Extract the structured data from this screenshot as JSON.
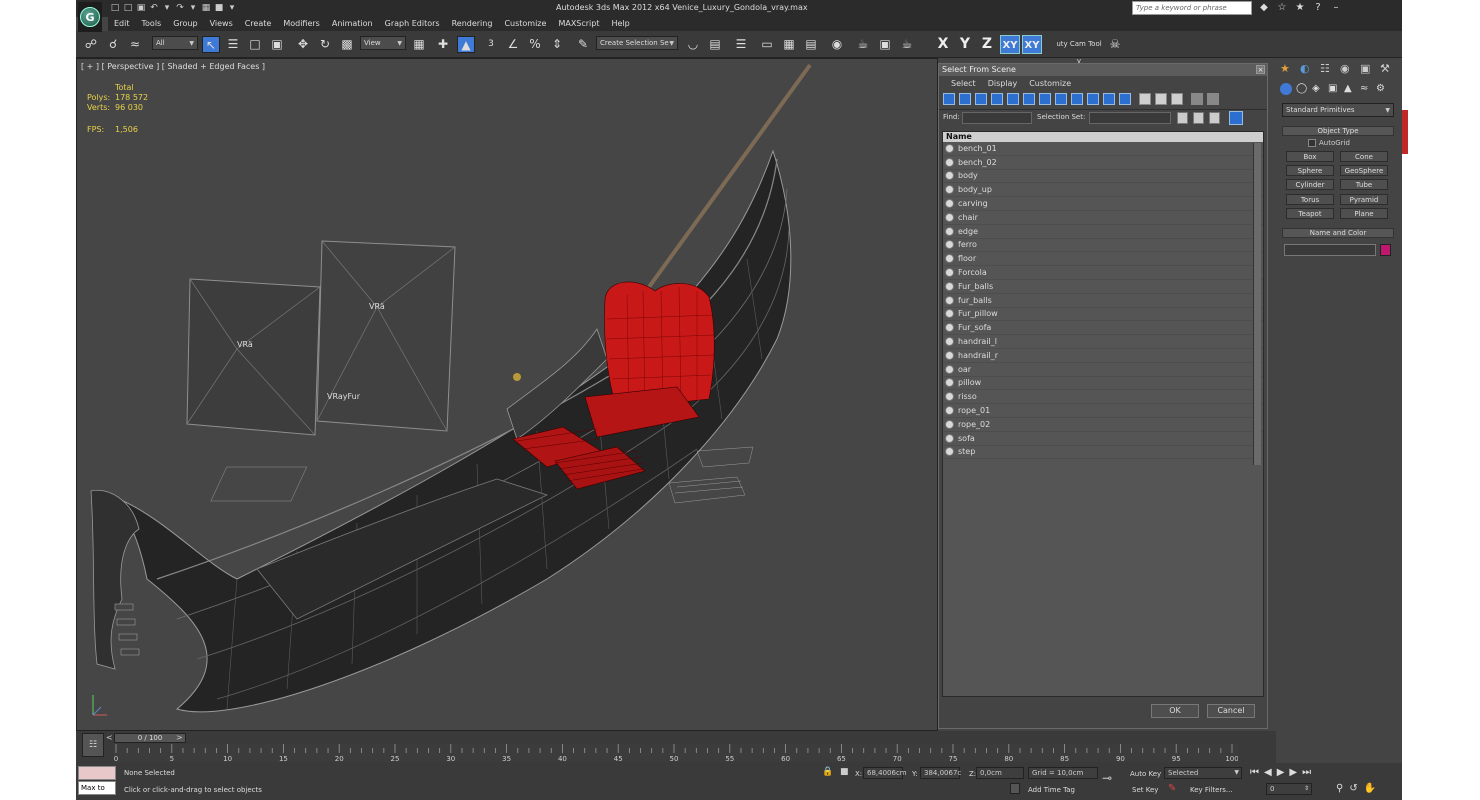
{
  "window": {
    "title": "Autodesk 3ds Max  2012 x64     Venice_Luxury_Gondola_vray.max",
    "help_placeholder": "Type a keyword or phrase",
    "logo_letter": "G"
  },
  "menu": [
    "Edit",
    "Tools",
    "Group",
    "Views",
    "Create",
    "Modifiers",
    "Animation",
    "Graph Editors",
    "Rendering",
    "Customize",
    "MAXScript",
    "Help"
  ],
  "toolbar": {
    "filter_value": "All",
    "refcoord_value": "View",
    "selection_set_placeholder": "Create Selection Se",
    "axes": [
      "X",
      "Y",
      "Z",
      "XY",
      "XY"
    ],
    "snap_value": "3",
    "beauty_tool": "uty Cam Tool v"
  },
  "viewport": {
    "label": "[ + ] [ Perspective ] [ Shaded + Edged Faces ]",
    "stats": {
      "total_label": "Total",
      "polys_label": "Polys:",
      "polys_value": "178 572",
      "verts_label": "Verts:",
      "verts_value": "96 030",
      "fps_label": "FPS:",
      "fps_value": "1,506"
    },
    "light1_label": "VRä",
    "light2_label": "VRä",
    "fur_label": "VRayFur"
  },
  "dialog": {
    "title": "Select From Scene",
    "menu": [
      "Select",
      "Display",
      "Customize"
    ],
    "find_label": "Find:",
    "selset_label": "Selection Set:",
    "list_header": "Name",
    "items": [
      "bench_01",
      "bench_02",
      "body",
      "body_up",
      "carving",
      "chair",
      "edge",
      "ferro",
      "floor",
      "Forcola",
      "Fur_balls",
      "fur_balls",
      "Fur_pillow",
      "Fur_sofa",
      "handrail_l",
      "handrail_r",
      "oar",
      "pillow",
      "risso",
      "rope_01",
      "rope_02",
      "sofa",
      "step"
    ],
    "ok": "OK",
    "cancel": "Cancel"
  },
  "command_panel": {
    "dropdown": "Standard Primitives",
    "object_type_label": "Object Type",
    "autogrid_label": "AutoGrid",
    "buttons": [
      "Box",
      "Cone",
      "Sphere",
      "GeoSphere",
      "Cylinder",
      "Tube",
      "Torus",
      "Pyramid",
      "Teapot",
      "Plane"
    ],
    "name_color_label": "Name and Color",
    "color_swatch": "#c0176e"
  },
  "timeline": {
    "slider": "0 / 100",
    "ticks": [
      "0",
      "5",
      "10",
      "15",
      "20",
      "25",
      "30",
      "35",
      "40",
      "45",
      "50",
      "55",
      "60",
      "65",
      "70",
      "75",
      "80",
      "85",
      "90",
      "95",
      "100"
    ]
  },
  "status": {
    "maxscript_label": "Max to",
    "selection": "None Selected",
    "prompt": "Click or click-and-drag to select objects",
    "x_label": "X:",
    "x_value": "68,4006cm",
    "y_label": "Y:",
    "y_value": "384,0067c",
    "z_label": "Z:",
    "z_value": "0,0cm",
    "grid": "Grid = 10,0cm",
    "add_time_tag": "Add Time Tag",
    "auto_key": "Auto Key",
    "set_key": "Set Key",
    "selected_value": "Selected",
    "key_filters": "Key Filters...",
    "frame_value": "0"
  }
}
